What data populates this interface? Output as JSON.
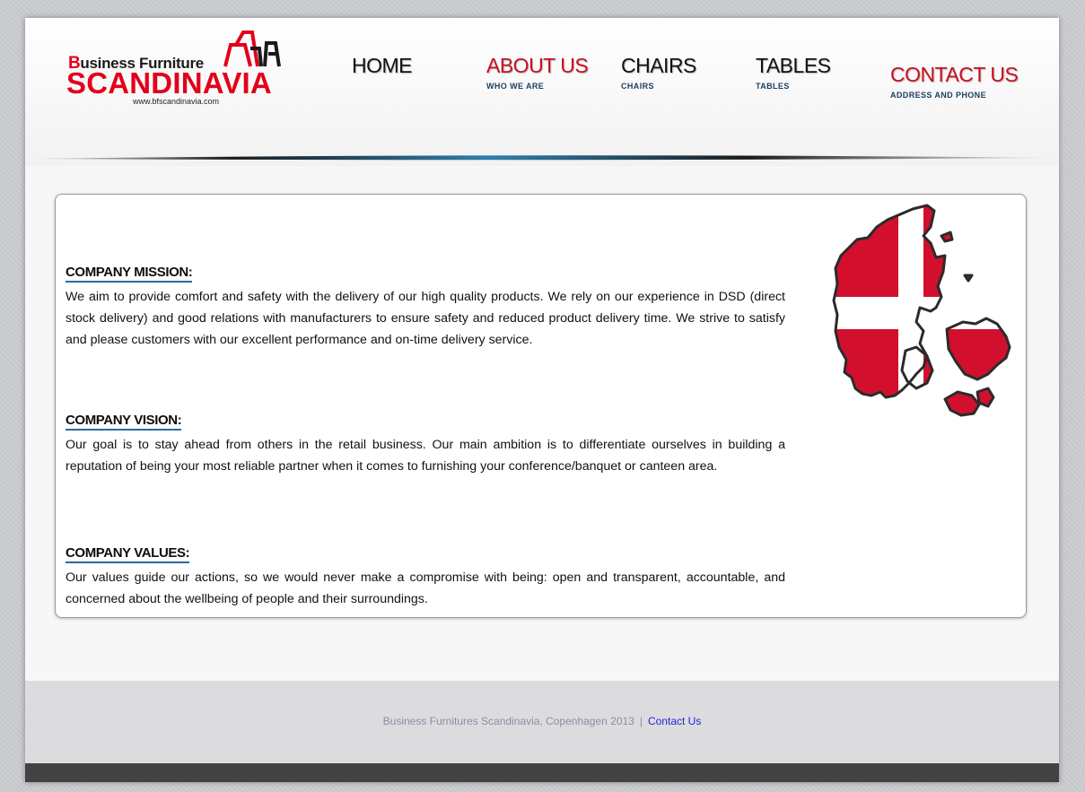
{
  "logo": {
    "line1_initial": "B",
    "line1_rest": "usiness Furniture",
    "main": "SCANDINAVIA",
    "url": "www.bfscandinavia.com",
    "icon": "chair-logo-icon"
  },
  "nav": [
    {
      "label": "HOME",
      "sub": ""
    },
    {
      "label": "ABOUT US",
      "sub": "WHO WE ARE"
    },
    {
      "label": "CHAIRS",
      "sub": "CHAIRS"
    },
    {
      "label": "TABLES",
      "sub": "TABLES"
    },
    {
      "label": "CONTACT US",
      "sub": "ADDRESS AND PHONE"
    }
  ],
  "sections": [
    {
      "title": "COMPANY MISSION:",
      "text": "We aim to provide comfort and safety with the delivery of our high quality products. We rely on our experience in DSD (direct stock delivery) and good relations with manufacturers to ensure safety and reduced product delivery time. We strive to satisfy and please customers with our excellent performance and on-time delivery service."
    },
    {
      "title": "COMPANY VISION:",
      "text": "Our goal is to stay ahead from others in the retail business. Our main ambition is to differentiate ourselves in building a reputation of being your most reliable partner when it comes to furnishing your conference/banquet or canteen area."
    },
    {
      "title": "COMPANY VALUES:",
      "text": "Our values guide our actions, so we would never make a compromise with being: open and transparent, accountable, and concerned about the wellbeing of people and their surroundings."
    }
  ],
  "map": {
    "icon": "denmark-flag-map-icon",
    "colors": {
      "red": "#d2102e",
      "white": "#ffffff",
      "outline": "#2b2b2b"
    }
  },
  "footer": {
    "text": "Business Furnitures Scandinavia, Copenhagen 2013",
    "separator": "|",
    "link": "Contact Us"
  },
  "colors": {
    "accent_red": "#c8101d",
    "nav_sub": "#1d3d5e",
    "underline_blue": "#2a6aa0",
    "link": "#2323d6"
  }
}
